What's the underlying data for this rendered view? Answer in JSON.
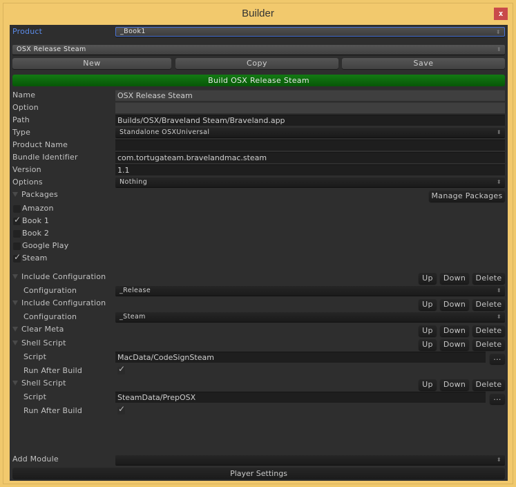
{
  "window": {
    "title": "Builder",
    "close_label": "x"
  },
  "product": {
    "label": "Product",
    "value": "_Book1"
  },
  "configuration_select": {
    "value": "OSX Release Steam"
  },
  "toolbar": {
    "new_label": "New",
    "copy_label": "Copy",
    "save_label": "Save"
  },
  "build_button": {
    "label": "Build OSX Release Steam",
    "color": "#0b660b"
  },
  "fields": {
    "name": {
      "label": "Name",
      "value": "OSX Release Steam"
    },
    "option": {
      "label": "Option",
      "value": ""
    },
    "path": {
      "label": "Path",
      "value": "Builds/OSX/Braveland Steam/Braveland.app"
    },
    "type": {
      "label": "Type",
      "value": "Standalone OSXUniversal"
    },
    "product_name": {
      "label": "Product Name",
      "value": ""
    },
    "bundle_identifier": {
      "label": "Bundle Identifier",
      "value": "com.tortugateam.bravelandmac.steam"
    },
    "version": {
      "label": "Version",
      "value": "1.1"
    },
    "options": {
      "label": "Options",
      "value": "Nothing"
    }
  },
  "packages": {
    "label": "Packages",
    "manage_label": "Manage Packages",
    "items": [
      {
        "label": "Amazon",
        "checked": false
      },
      {
        "label": "Book 1",
        "checked": true
      },
      {
        "label": "Book 2",
        "checked": false
      },
      {
        "label": "Google Play",
        "checked": false
      },
      {
        "label": "Steam",
        "checked": true
      }
    ]
  },
  "module_buttons": {
    "up": "Up",
    "down": "Down",
    "delete": "Delete",
    "browse": "..."
  },
  "modules": [
    {
      "title": "Include Configuration",
      "field_label": "Configuration",
      "field_value": "_Release"
    },
    {
      "title": "Include Configuration",
      "field_label": "Configuration",
      "field_value": "_Steam"
    },
    {
      "title": "Clear Meta"
    },
    {
      "title": "Shell Script",
      "script_label": "Script",
      "script_value": "MacData/CodeSignSteam",
      "run_label": "Run After Build",
      "run_checked": true
    },
    {
      "title": "Shell Script",
      "script_label": "Script",
      "script_value": "SteamData/PrepOSX",
      "run_label": "Run After Build",
      "run_checked": true
    }
  ],
  "add_module": {
    "label": "Add Module",
    "value": ""
  },
  "player_settings": {
    "label": "Player Settings"
  },
  "icons": {
    "check": "✓",
    "popup_arrows": "⬍"
  }
}
